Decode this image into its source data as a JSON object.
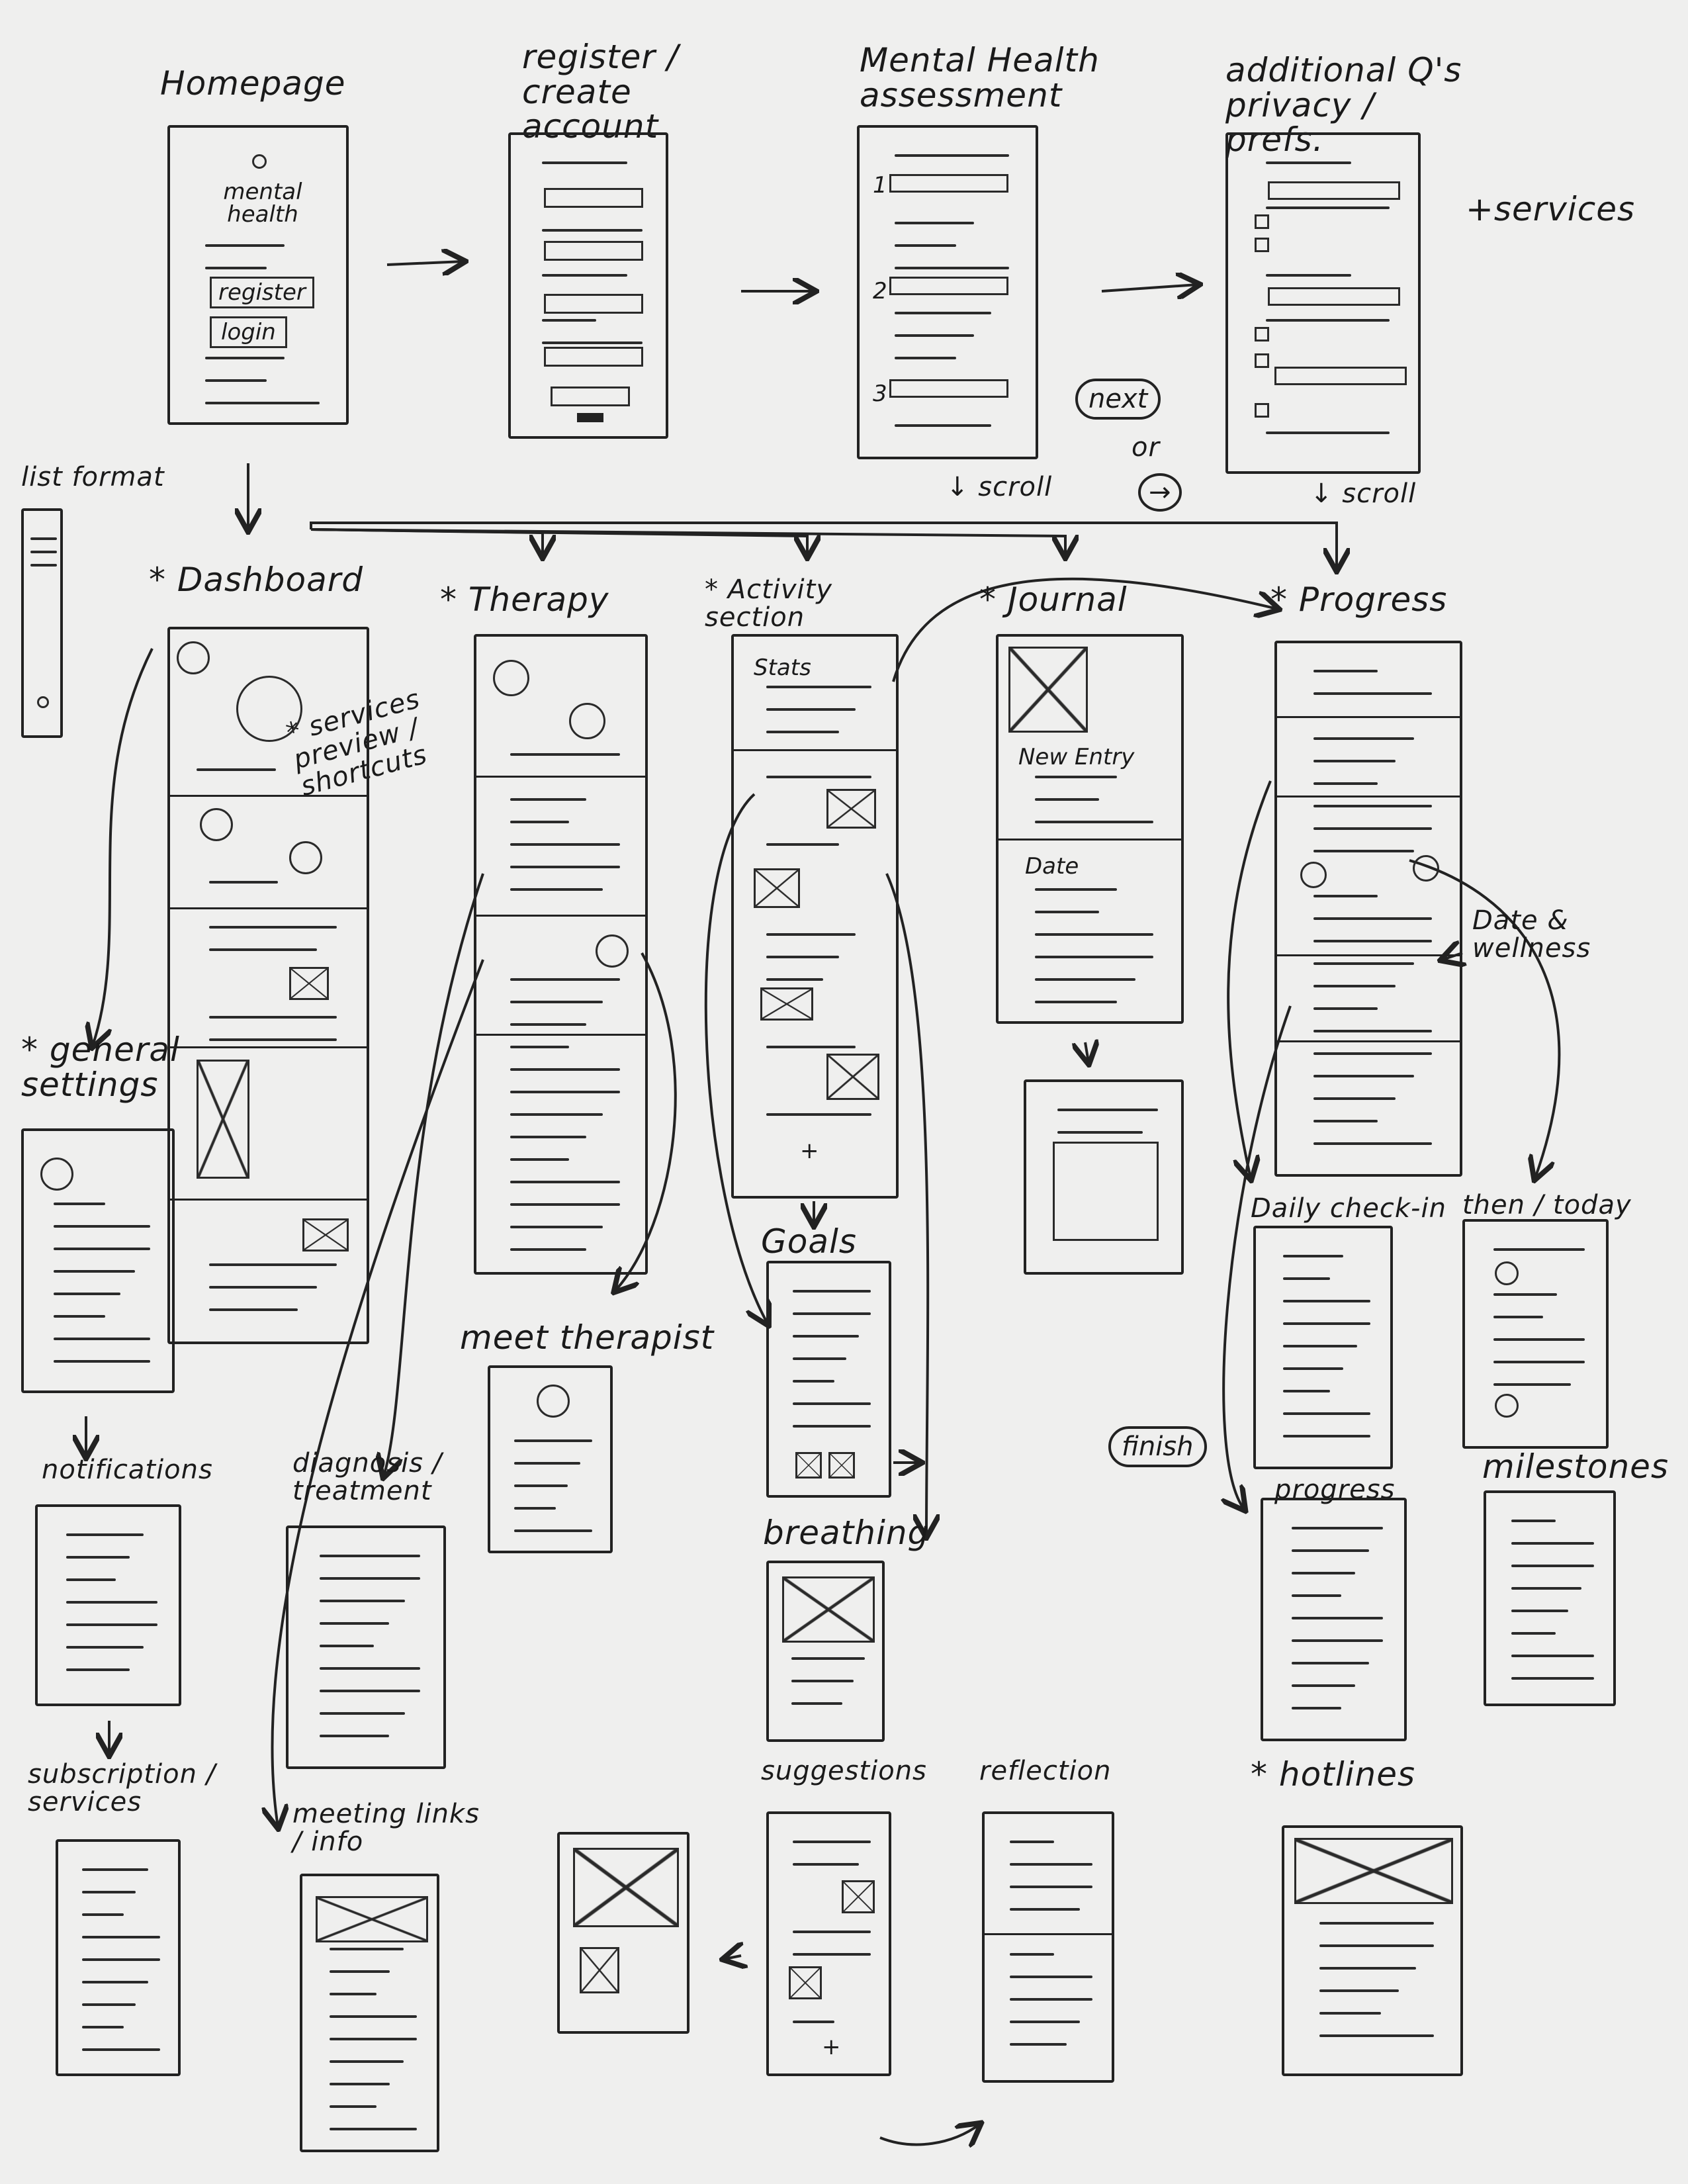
{
  "screens": {
    "homepage": {
      "label": "Homepage",
      "app_name": "mental health",
      "register_button": "register",
      "login_button": "login"
    },
    "register": {
      "label": "register / create account"
    },
    "assessment": {
      "label": "Mental Health assessment",
      "q1": "1",
      "q2": "2",
      "q3": "3"
    },
    "additional": {
      "label": "additional Q's privacy / prefs."
    },
    "services_note": "+services",
    "list_format": {
      "label": "list format"
    },
    "dashboard": {
      "label": "* Dashboard",
      "note": "* services preview / shortcuts"
    },
    "therapy": {
      "label": "* Therapy"
    },
    "activity": {
      "label": "* Activity section",
      "stats": "Stats",
      "add": "+"
    },
    "journal": {
      "label": "* Journal",
      "new_entry": "New Entry",
      "date": "Date"
    },
    "progress": {
      "label": "* Progress",
      "note": "Date & wellness"
    },
    "general_settings": {
      "label": "* general settings"
    },
    "goals": {
      "label": "Goals"
    },
    "daily_checkin": {
      "label": "Daily check-in"
    },
    "then_today": {
      "label": "then / today"
    },
    "meet_therapist": {
      "label": "meet therapist"
    },
    "notifications": {
      "label": "notifications"
    },
    "diagnosis": {
      "label": "diagnosis / treatment"
    },
    "breathing": {
      "label": "breathing"
    },
    "progress_detail": {
      "label": "progress"
    },
    "milestones": {
      "label": "milestones"
    },
    "subscription": {
      "label": "subscription / services"
    },
    "meeting_links": {
      "label": "meeting links / info"
    },
    "suggestions": {
      "label": "suggestions",
      "add": "+"
    },
    "reflection": {
      "label": "reflection"
    },
    "hotlines": {
      "label": "* hotlines"
    }
  },
  "controls": {
    "next": "next",
    "or": "or",
    "next_arrow": "→",
    "scroll_1": "↓ scroll",
    "scroll_2": "↓ scroll",
    "finish": "finish"
  }
}
